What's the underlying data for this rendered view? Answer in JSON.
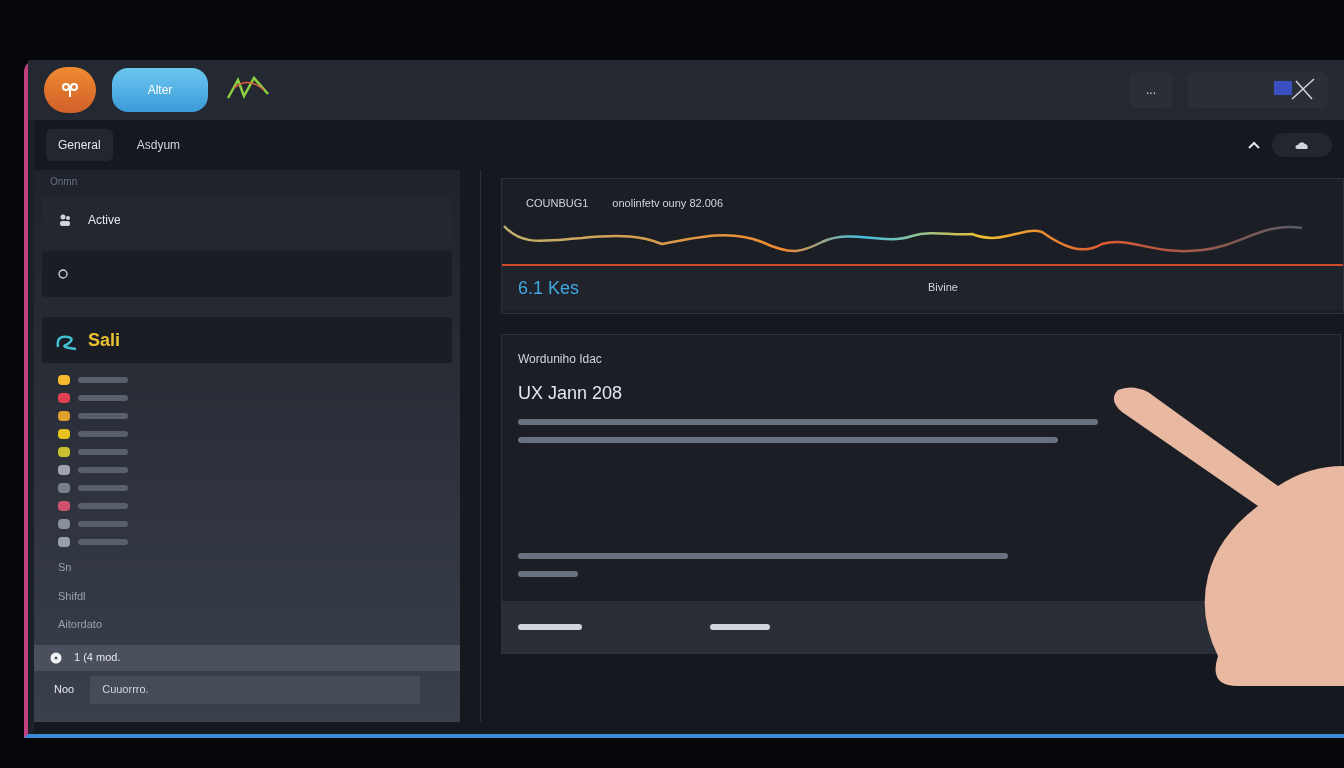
{
  "header": {
    "app_button": "Alter",
    "menu_button": "..."
  },
  "tabs": [
    {
      "label": "General",
      "selected": true
    },
    {
      "label": "Asdyum",
      "selected": false
    }
  ],
  "sidebar": {
    "section_label": "Onmn",
    "items": [
      {
        "label": "Active",
        "selected": true
      },
      {
        "kind": "icon",
        "selected": false
      }
    ],
    "brand": "Sali",
    "legend": [
      {
        "color": "#f5b82e"
      },
      {
        "color": "#e0404e"
      },
      {
        "color": "#e0a030"
      },
      {
        "color": "#e8c020"
      },
      {
        "color": "#c8c030"
      },
      {
        "color": "#a0a4b0"
      },
      {
        "color": "#7a7f8c"
      },
      {
        "color": "#d05070"
      },
      {
        "color": "#8a8f9c"
      },
      {
        "color": "#9aa0ac"
      }
    ],
    "links": [
      "Sn",
      "Shifdl",
      "Aitordato"
    ],
    "status_row": "1 (4 mod.",
    "field_label": "Noo",
    "field_value": "Cuuorrro."
  },
  "chart_card": {
    "title": "COUNBUG1",
    "subtitle": "onolinfetv ouny 82.006",
    "value": "6.1 Kes",
    "center_label": "Bivine"
  },
  "text_card": {
    "eyebrow": "Worduniho Idac",
    "title": "UX Jann 208"
  }
}
